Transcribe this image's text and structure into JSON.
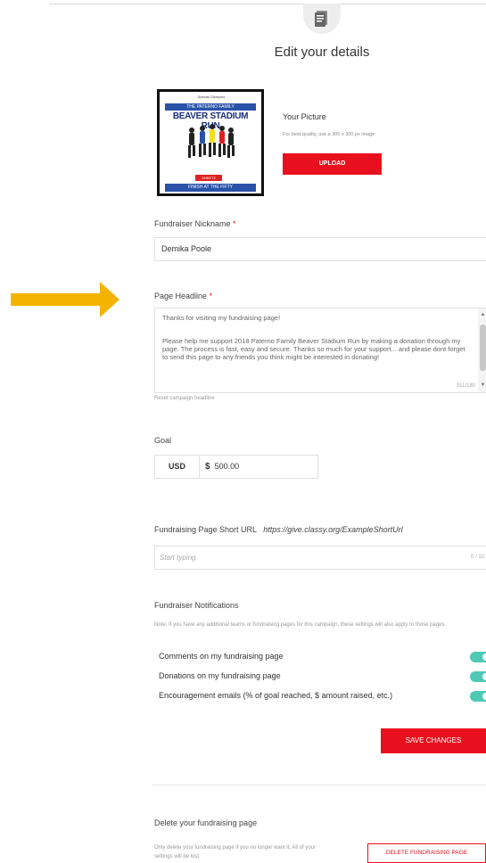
{
  "header": {
    "title": "Edit your details",
    "icon": "document-icon"
  },
  "picture": {
    "label": "Your Picture",
    "hint": "For best quality, use a 300 x 300 px image",
    "upload_label": "UPLOAD",
    "image": {
      "logo_text": "Special Olympics",
      "family_text": "THE PATERNO FAMILY",
      "title_text": "BEAVER STADIUM RUN",
      "sponsor_text": "SHEETZ",
      "finish_text": "FINISH AT THE FIFTY"
    }
  },
  "nickname": {
    "label": "Fundraiser Nickname",
    "required_mark": "*",
    "value": "Demika Poole"
  },
  "headline": {
    "label": "Page Headline",
    "required_mark": "*",
    "line1": "Thanks for visiting my fundraising page!",
    "line2": "Please help me support 2018 Paterno Family Beaver Stadium Run by making a donation through my page. The process is fast, easy and secure. Thanks so much for your support... and please dont forget to send this page to any friends you think might be interested in donating!",
    "char_count": "311/180",
    "reset_label": "Reset campaign headline"
  },
  "goal": {
    "label": "Goal",
    "currency": "USD",
    "symbol": "$",
    "value": "500.00"
  },
  "short_url": {
    "label": "Fundraising Page Short URL",
    "url": "https://give.classy.org/ExampleShortUrl",
    "placeholder": "Start typing",
    "char_count": "0 / 10"
  },
  "notifications": {
    "title": "Fundraiser Notifications",
    "note": "Note: If you have any additional teams or fundraising pages for this campaign, these settings will also apply to those pages.",
    "items": [
      {
        "label": "Comments on my fundraising page",
        "enabled": true
      },
      {
        "label": "Donations on my fundraising page",
        "enabled": true
      },
      {
        "label": "Encouragement emails (% of goal reached, $ amount raised, etc.)",
        "enabled": true
      }
    ],
    "toggle_color": "#4fc9b4"
  },
  "save_label": "SAVE CHANGES",
  "delete": {
    "title": "Delete your fundraising page",
    "note": "Only delete your fundraising page if you no longer want it. All of your settings will be lost.",
    "button_label": "DELETE FUNDRAISING PAGE"
  },
  "colors": {
    "accent": "#e8101e",
    "arrow": "#f5b301"
  }
}
